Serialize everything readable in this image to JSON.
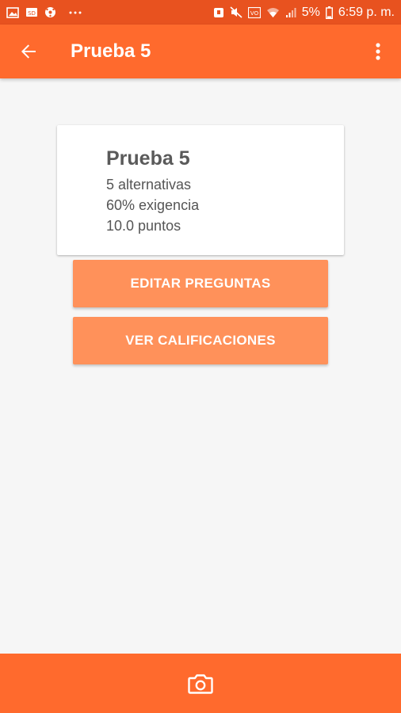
{
  "status_bar": {
    "battery_percent": "5%",
    "time": "6:59 p. m.",
    "left_icons": [
      "image-icon",
      "sd-card-icon",
      "soccer-ball-icon",
      "more-dots-icon"
    ],
    "right_icons": [
      "alarm-icon",
      "mute-icon",
      "volte-icon",
      "wifi-icon",
      "signal-icon",
      "battery-icon"
    ]
  },
  "app_bar": {
    "title": "Prueba 5",
    "back_icon": "arrow-back-icon",
    "menu_icon": "more-vert-icon"
  },
  "card": {
    "title": "Prueba 5",
    "alternatives": "5 alternativas",
    "requirement": "60% exigencia",
    "points": "10.0 puntos"
  },
  "buttons": {
    "edit_questions": "EDITAR PREGUNTAS",
    "view_grades": "VER CALIFICACIONES"
  },
  "bottom_bar": {
    "camera_icon": "camera-icon"
  },
  "colors": {
    "status_bar": "#e8521f",
    "primary": "#ff6a2d",
    "button": "#ff915a",
    "background": "#f6f6f6"
  }
}
